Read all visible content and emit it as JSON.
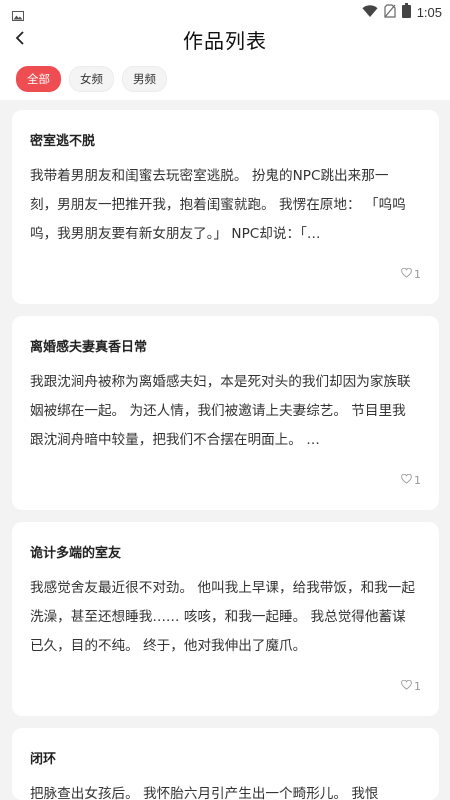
{
  "status_bar": {
    "time": "1:05"
  },
  "header": {
    "title": "作品列表"
  },
  "filters": [
    {
      "label": "全部",
      "active": true
    },
    {
      "label": "女频",
      "active": false
    },
    {
      "label": "男频",
      "active": false
    }
  ],
  "works": [
    {
      "title": "密室逃不脱",
      "excerpt": "我带着男朋友和闺蜜去玩密室逃脱。 扮鬼的NPC跳出来那一刻，男朋友一把推开我，抱着闺蜜就跑。 我愣在原地： 「呜呜呜，我男朋友要有新女朋友了。」 NPC却说：「…",
      "likes": "1"
    },
    {
      "title": "离婚感夫妻真香日常",
      "excerpt": "我跟沈涧舟被称为离婚感夫妇，本是死对头的我们却因为家族联姻被绑在一起。 为还人情，我们被邀请上夫妻综艺。 节目里我跟沈涧舟暗中较量，把我们不合摆在明面上。 …",
      "likes": "1"
    },
    {
      "title": "诡计多端的室友",
      "excerpt": "我感觉舍友最近很不对劲。 他叫我上早课，给我带饭，和我一起洗澡，甚至还想睡我…… 咳咳，和我一起睡。 我总觉得他蓄谋已久，目的不纯。 终于，他对我伸出了魔爪。",
      "likes": "1"
    },
    {
      "title": "闭环",
      "excerpt": "把脉查出女孩后。 我怀胎六月引产生出一个畸形儿。 我恨",
      "likes": ""
    }
  ]
}
